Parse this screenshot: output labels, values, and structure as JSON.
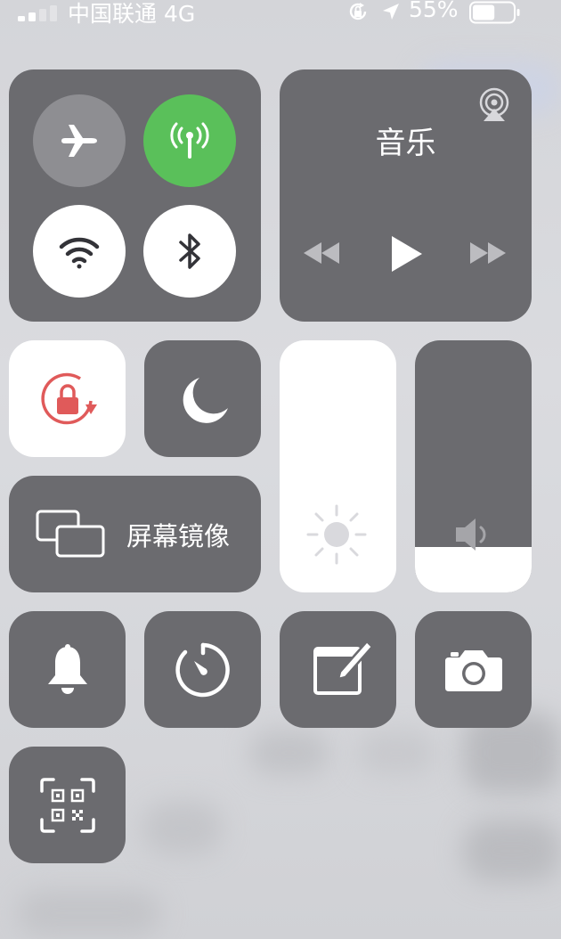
{
  "status_bar": {
    "carrier": "中国联通 4G",
    "battery_percent": "55%",
    "battery_level": 0.55,
    "signal_bars_filled": 2,
    "signal_bars_total": 4
  },
  "connectivity": {
    "airplane": {
      "icon": "airplane-icon",
      "enabled": false
    },
    "cellular": {
      "icon": "antenna-icon",
      "enabled": true,
      "color": "#5ac05a"
    },
    "wifi": {
      "icon": "wifi-icon",
      "enabled": true
    },
    "bluetooth": {
      "icon": "bluetooth-icon",
      "enabled": true
    }
  },
  "music": {
    "title": "音乐",
    "airplay_icon": "airplay-icon",
    "controls": [
      "rewind-icon",
      "play-icon",
      "fast-forward-icon"
    ]
  },
  "orientation_lock": {
    "icon": "rotation-lock-icon",
    "enabled": true,
    "color": "#e05a5a"
  },
  "do_not_disturb": {
    "icon": "moon-icon",
    "enabled": false
  },
  "brightness": {
    "icon": "sun-icon",
    "level": 1.0
  },
  "volume": {
    "icon": "speaker-icon",
    "level": 0.18
  },
  "screen_mirroring": {
    "label": "屏幕镜像",
    "icon": "screen-mirroring-icon"
  },
  "shortcuts": [
    {
      "name": "bell",
      "icon": "bell-icon"
    },
    {
      "name": "timer",
      "icon": "timer-icon"
    },
    {
      "name": "notes",
      "icon": "notes-icon"
    },
    {
      "name": "camera",
      "icon": "camera-icon"
    },
    {
      "name": "qr-scanner",
      "icon": "qr-code-icon"
    }
  ],
  "colors": {
    "tile": "#6b6b6f",
    "active_green": "#5ac05a",
    "lock_red": "#e05a5a",
    "inactive_circle": "#8e8e92"
  }
}
